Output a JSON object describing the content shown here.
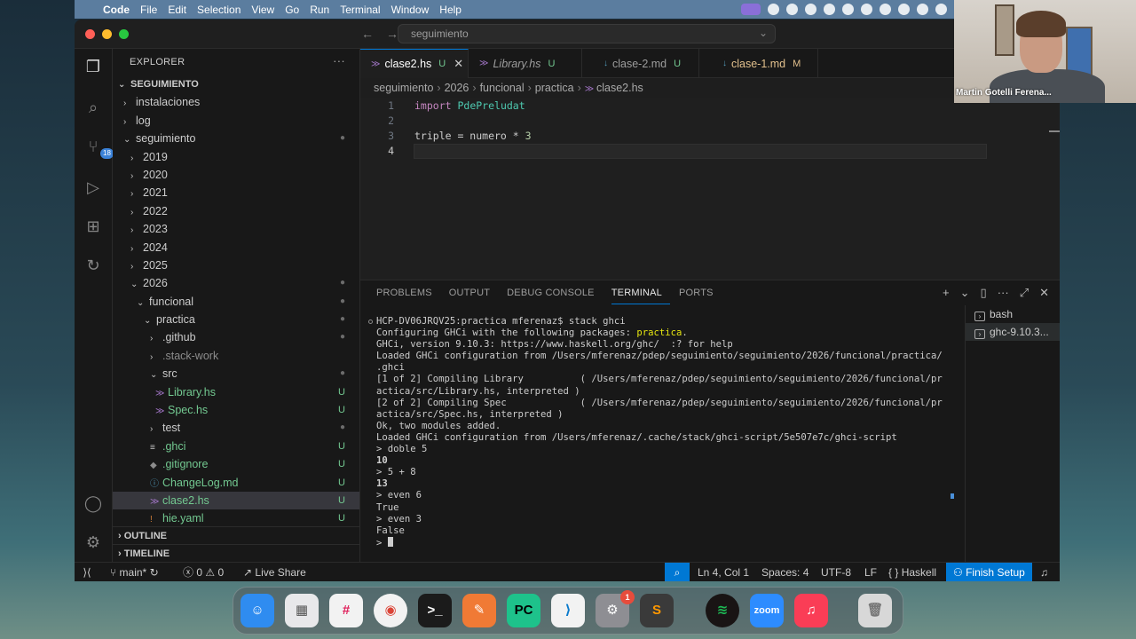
{
  "menubar": {
    "app": "Code",
    "items": [
      "File",
      "Edit",
      "Selection",
      "View",
      "Go",
      "Run",
      "Terminal",
      "Window",
      "Help"
    ]
  },
  "titlebar": {
    "search": "seguimiento"
  },
  "activity": {
    "scm_badge": "18"
  },
  "explorer": {
    "title": "EXPLORER",
    "root": "SEGUIMIENTO",
    "rows": [
      {
        "label": "instalaciones",
        "status": ""
      },
      {
        "label": "log",
        "status": ""
      },
      {
        "label": "seguimiento",
        "status": "●"
      },
      {
        "label": "2019",
        "status": ""
      },
      {
        "label": "2020",
        "status": ""
      },
      {
        "label": "2021",
        "status": ""
      },
      {
        "label": "2022",
        "status": ""
      },
      {
        "label": "2023",
        "status": ""
      },
      {
        "label": "2024",
        "status": ""
      },
      {
        "label": "2025",
        "status": ""
      },
      {
        "label": "2026",
        "status": "●"
      },
      {
        "label": "funcional",
        "status": "●"
      },
      {
        "label": "practica",
        "status": "●"
      },
      {
        "label": ".github",
        "status": "●"
      },
      {
        "label": ".stack-work",
        "status": ""
      },
      {
        "label": "src",
        "status": "●"
      },
      {
        "label": "Library.hs",
        "status": "U"
      },
      {
        "label": "Spec.hs",
        "status": "U"
      },
      {
        "label": "test",
        "status": "●"
      },
      {
        "label": ".ghci",
        "status": "U"
      },
      {
        "label": ".gitignore",
        "status": "U"
      },
      {
        "label": "ChangeLog.md",
        "status": "U"
      },
      {
        "label": "clase2.hs",
        "status": "U"
      },
      {
        "label": "hie.yaml",
        "status": "U"
      }
    ],
    "outline": "OUTLINE",
    "timeline": "TIMELINE"
  },
  "tabs": [
    {
      "label": "clase2.hs",
      "mark": "U"
    },
    {
      "label": "Library.hs",
      "mark": "U"
    },
    {
      "label": "clase-2.md",
      "mark": "U"
    },
    {
      "label": "clase-1.md",
      "mark": "M"
    }
  ],
  "breadcrumb": [
    "seguimiento",
    "2026",
    "funcional",
    "practica",
    "clase2.hs"
  ],
  "editor": {
    "line_numbers": [
      "1",
      "2",
      "3",
      "4"
    ],
    "line1_kw": "import",
    "line1_mod": "PdePreludat",
    "line3_a": "triple = numero * ",
    "line3_num": "3"
  },
  "panel": {
    "tabs": [
      "PROBLEMS",
      "OUTPUT",
      "DEBUG CONSOLE",
      "TERMINAL",
      "PORTS"
    ],
    "terminal_lines": {
      "l1": "HCP-DV06JRQV25:practica mferenaz$ stack ghci",
      "l2a": "Configuring GHCi with the following packages: ",
      "l2b": "practica",
      "l2c": ".",
      "l3": "GHCi, version 9.10.3: https://www.haskell.org/ghc/  :? for help",
      "l4": "Loaded GHCi configuration from /Users/mferenaz/pdep/seguimiento/seguimiento/2026/funcional/practica/",
      "l5": ".ghci",
      "l6": "[1 of 2] Compiling Library          ( /Users/mferenaz/pdep/seguimiento/seguimiento/2026/funcional/pr",
      "l7": "actica/src/Library.hs, interpreted )",
      "l8": "[2 of 2] Compiling Spec             ( /Users/mferenaz/pdep/seguimiento/seguimiento/2026/funcional/pr",
      "l9": "actica/src/Spec.hs, interpreted )",
      "l10": "Ok, two modules added.",
      "l11": "Loaded GHCi configuration from /Users/mferenaz/.cache/stack/ghci-script/5e507e7c/ghci-script",
      "l12": "> doble 5",
      "l13": "10",
      "l14": "> 5 + 8",
      "l15": "13",
      "l16": "> even 6",
      "l17": "True",
      "l18": "> even 3",
      "l19": "False",
      "l20": "> "
    },
    "terminals": [
      "bash",
      "ghc-9.10.3..."
    ]
  },
  "statusbar": {
    "branch": "main*",
    "errors": "0",
    "warnings": "0",
    "live_share": "Live Share",
    "position": "Ln 4, Col 1",
    "spaces": "Spaces: 4",
    "encoding": "UTF-8",
    "eol": "LF",
    "language": "Haskell",
    "finish_setup": "Finish Setup"
  },
  "webcam": {
    "name": "Martin Gotelli Ferena..."
  },
  "dock": {
    "items": [
      {
        "name": "finder",
        "color": "#2f8cf0"
      },
      {
        "name": "launchpad",
        "color": "#e8e8ea"
      },
      {
        "name": "slack",
        "color": "#f2f2f2"
      },
      {
        "name": "chrome",
        "color": "#f2f2f2"
      },
      {
        "name": "terminal",
        "color": "#1b1b1b"
      },
      {
        "name": "pencil",
        "color": "#f07a35"
      },
      {
        "name": "pycharm",
        "color": "#1ec28b"
      },
      {
        "name": "vscode",
        "color": "#f2f2f2"
      },
      {
        "name": "settings",
        "color": "#8e8e93"
      },
      {
        "name": "sublime",
        "color": "#3a3a3a"
      },
      {
        "name": "spotify",
        "color": "#191414"
      },
      {
        "name": "zoom",
        "color": "#2d8cff"
      },
      {
        "name": "music",
        "color": "#fa3d56"
      },
      {
        "name": "trash",
        "color": "#d8d8d8"
      }
    ],
    "zoom_label": "zoom",
    "settings_badge": "1"
  }
}
